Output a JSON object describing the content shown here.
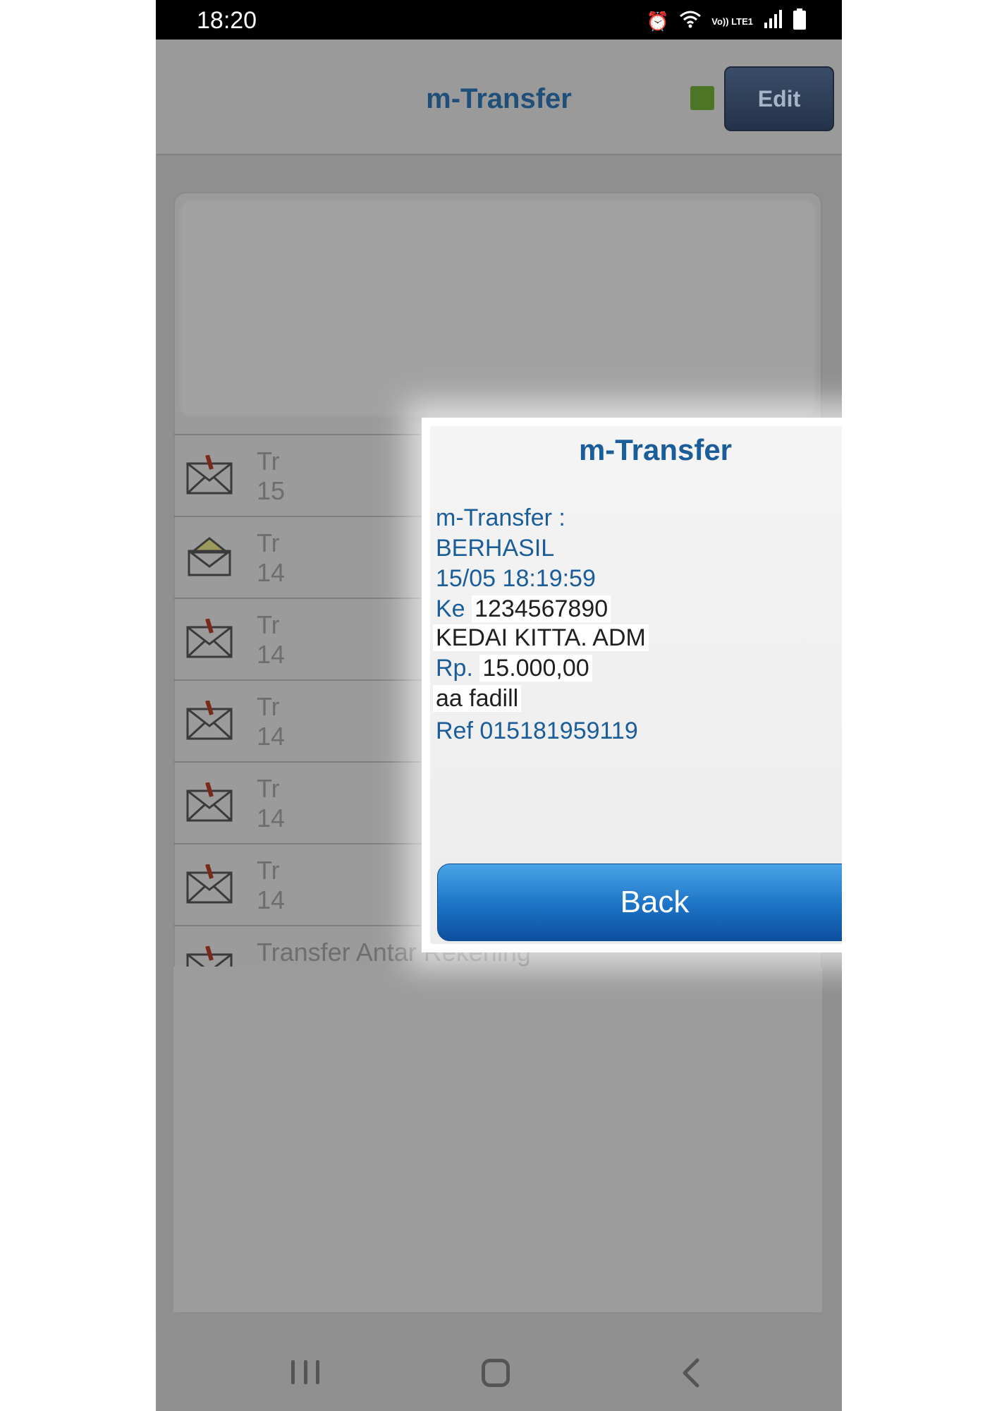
{
  "status_bar": {
    "time": "18:20",
    "icons": [
      "alarm-icon",
      "wifi-icon",
      "volte-lte1-icon",
      "signal-icon",
      "battery-icon"
    ],
    "volte_label": "Vo)) LTE1"
  },
  "header": {
    "title": "m-Transfer",
    "edit_label": "Edit",
    "indicator_color": "#4d7526"
  },
  "background_list": {
    "rows": [
      {
        "text": "Tr\n15",
        "icon": "envelope-alert-icon"
      },
      {
        "text": "Tr\n14",
        "icon": "envelope-open-icon"
      },
      {
        "text": "Tr\n14",
        "icon": "envelope-alert-icon"
      },
      {
        "text": "Tr\n14",
        "icon": "envelope-alert-icon"
      },
      {
        "text": "Tr\n14",
        "icon": "envelope-alert-icon"
      },
      {
        "text": "Tr\n14",
        "icon": "envelope-alert-icon"
      },
      {
        "text": "Transfer Antar Rekening",
        "icon": "envelope-alert-icon"
      }
    ]
  },
  "dialog": {
    "title": "m-Transfer",
    "lines": {
      "header": "m-Transfer :",
      "status": "BERHASIL",
      "datetime": "15/05 18:19:59",
      "to_label": "Ke",
      "to_account": "1234567890",
      "recipient": "KEDAI KITTA. ADM",
      "currency": "Rp.",
      "amount": "15.000,00",
      "note": "aa fadill",
      "ref": "Ref 015181959119"
    },
    "back_label": "Back",
    "button_color": "#1c72c5"
  },
  "nav_bar": {
    "icons": [
      "recent-apps-icon",
      "home-icon",
      "back-icon"
    ]
  }
}
